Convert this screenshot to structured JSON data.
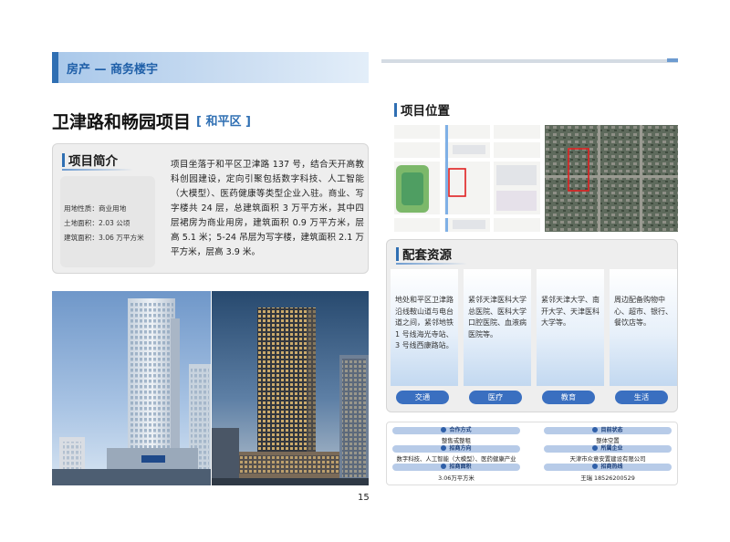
{
  "header": {
    "section": "房产 — 商务楼宇"
  },
  "title": {
    "name": "卫津路和畅园项目",
    "district": "[ 和平区 ]"
  },
  "intro": {
    "heading": "项目简介",
    "stats": [
      "用地性质：商业用地",
      "土地面积：2.03 公顷",
      "建筑面积：3.06 万平方米"
    ],
    "paragraph": "项目坐落于和平区卫津路 137 号，结合天开高教科创园建设，定向引聚包括数字科技、人工智能（大模型）、医药健康等类型企业入驻。商业、写字楼共 24 层，总建筑面积 3 万平方米，其中四层裙房为商业用房，建筑面积 0.9 万平方米，层高 5.1 米；5-24 吊层为写字楼，建筑面积 2.1 万平方米，层高 3.9 米。"
  },
  "location": {
    "heading": "项目位置"
  },
  "resources": {
    "heading": "配套资源",
    "cards": [
      {
        "text": "地处和平区卫津路沿线鞍山道与电台道之间，紧邻地铁 1 号线海光寺站、3 号线西康路站。",
        "label": "交通"
      },
      {
        "text": "紧邻天津医科大学总医院、医科大学口腔医院、血液病医院等。",
        "label": "医疗"
      },
      {
        "text": "紧邻天津大学、南开大学、天津医科大学等。",
        "label": "教育"
      },
      {
        "text": "周边配备购物中心、超市、银行、餐饮店等。",
        "label": "生活"
      }
    ]
  },
  "info": {
    "left": [
      {
        "label": "合作方式",
        "value": "整售或整租"
      },
      {
        "label": "招商方向",
        "value": "数字科技、人工智能（大模型）、医药健康产业"
      },
      {
        "label": "招商面积",
        "value": "3.06万平方米"
      }
    ],
    "right": [
      {
        "label": "目前状态",
        "value": "整体空置"
      },
      {
        "label": "所属企业",
        "value": "天津市众意安置建设有限公司"
      },
      {
        "label": "招商热线",
        "value": "王瑞 18526200529"
      }
    ]
  },
  "page": {
    "number": "15"
  },
  "colors": {
    "accent": "#2f6fb3",
    "pill": "#3a6fc0",
    "panel": "#eeeeee"
  }
}
